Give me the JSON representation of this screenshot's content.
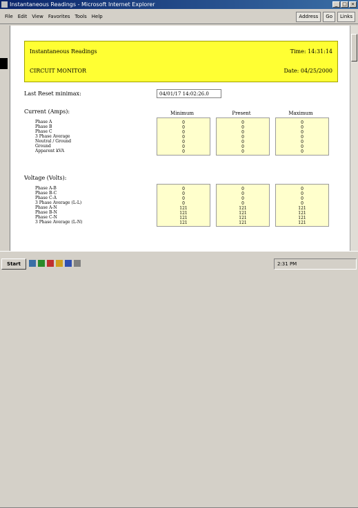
{
  "window": {
    "title": "Instantaneous Readings - Microsoft Internet Explorer"
  },
  "menu": [
    "File",
    "Edit",
    "View",
    "Favorites",
    "Tools",
    "Help"
  ],
  "toolbar": {
    "go_label": "Go",
    "links_label": "Links",
    "address_label": "Address"
  },
  "banner": {
    "title": "Instantaneous Readings",
    "time": "Time: 14:31:14",
    "subtitle": "CIRCUIT MONITOR",
    "date": "Date: 04/25/2000"
  },
  "reset": {
    "label": "Last Reset minimax:",
    "value": "04/01/17 14:02:26.0"
  },
  "columns": [
    "Minimum",
    "Present",
    "Maximum"
  ],
  "current": {
    "label": "Current (Amps):",
    "rows": [
      "Phase A",
      "Phase B",
      "Phase C",
      "3 Phase Average",
      "Neutral / Ground",
      "Ground",
      "Apparent kVA"
    ],
    "values": [
      [
        "0",
        "0",
        "0",
        "0",
        "0",
        "0",
        "0"
      ],
      [
        "0",
        "0",
        "0",
        "0",
        "0",
        "0",
        "0"
      ],
      [
        "0",
        "0",
        "0",
        "0",
        "0",
        "0",
        "0"
      ]
    ]
  },
  "voltage": {
    "label": "Voltage (Volts):",
    "rows": [
      "Phase A-B",
      "Phase B-C",
      "Phase C-A",
      "3 Phase Average (L-L)",
      "Phase A-N",
      "Phase B-N",
      "Phase C-N",
      "3 Phase Average (L-N)"
    ],
    "values": [
      [
        "0",
        "0",
        "0",
        "0",
        "121",
        "121",
        "121",
        "121"
      ],
      [
        "0",
        "0",
        "0",
        "0",
        "121",
        "121",
        "121",
        "121"
      ],
      [
        "0",
        "0",
        "0",
        "0",
        "121",
        "121",
        "121",
        "121"
      ]
    ]
  },
  "statusbar": {
    "text": ""
  },
  "taskbar": {
    "start_label": "Start",
    "clock": "2:31 PM"
  },
  "colors": {
    "banner": "#ffff33",
    "cell": "#ffffcc",
    "titlebar": "#0a246a"
  }
}
